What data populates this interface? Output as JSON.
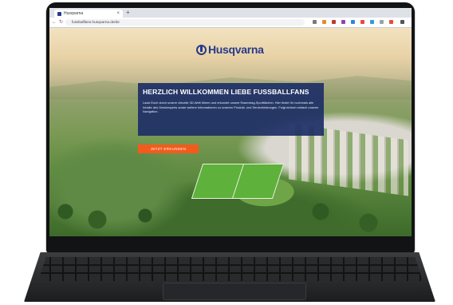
{
  "browser": {
    "tab_title": "Husqvarna",
    "url": "fussballfans.husqvarna.de/de",
    "new_tab_label": "+",
    "close_tab_label": "×"
  },
  "nav": {
    "back": "←",
    "forward": "→",
    "reload": "↻"
  },
  "page": {
    "brand": "Husqvarna",
    "headline": "HERZLICH WILLKOMMEN LIEBE FUSSBALLFANS",
    "intro": "Lasst Euch durch unsere virtuelle 3D-Welt führen und erkundet unsere Rasentrag-Sportflächen. Hier findet Ihr nochmals alle Inhalte des Gewinnspiels sowie weitere Informationen zu unseren Produkt- und Serviceleistungen. Folgt einfach einfach unserer Navigation.",
    "cta_label": "JETZT ERKUNDEN"
  },
  "colors": {
    "brand_blue": "#273a8a",
    "panel_blue": "#1d2f66",
    "cta_orange": "#f35b1c"
  }
}
